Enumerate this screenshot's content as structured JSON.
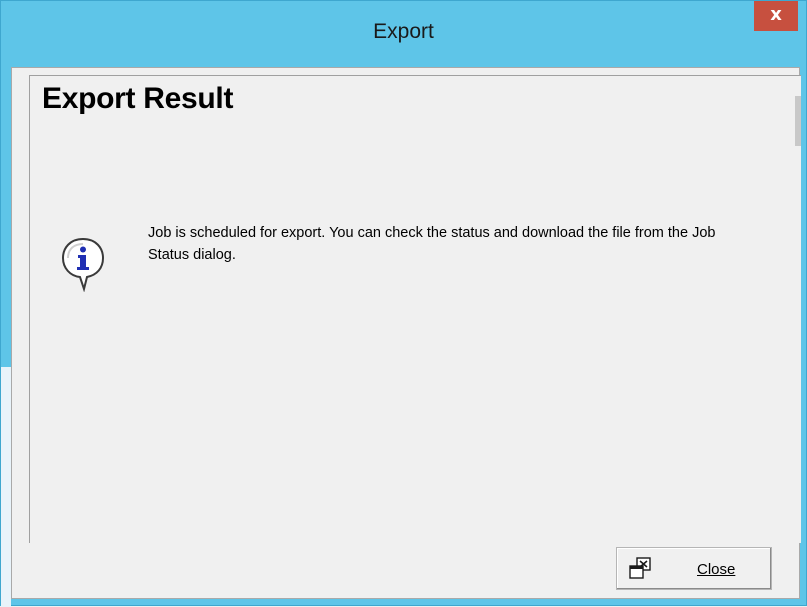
{
  "window": {
    "title": "Export",
    "close_glyph": "x",
    "colors": {
      "titlebar": "#5ec5e8",
      "close_button": "#c7503f",
      "dialog_bg": "#f0f0f0"
    }
  },
  "content": {
    "heading": "Export Result",
    "icon": "info-icon",
    "message": "Job is scheduled for export. You can check the status and download the file from the Job Status dialog."
  },
  "footer": {
    "close_button": {
      "label": "Close",
      "icon": "close-window-icon"
    }
  }
}
